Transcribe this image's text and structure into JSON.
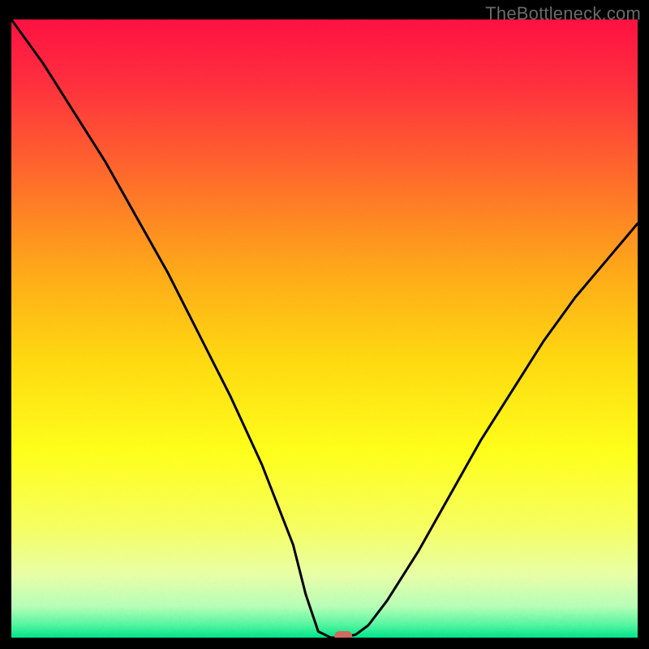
{
  "watermark": "TheBottleneck.com",
  "chart_data": {
    "type": "line",
    "title": "",
    "xlabel": "",
    "ylabel": "",
    "xlim": [
      0,
      100
    ],
    "ylim": [
      0,
      100
    ],
    "grid": false,
    "legend": false,
    "series": [
      {
        "name": "bottleneck-curve",
        "color": "#000000",
        "x": [
          0,
          5,
          10,
          15,
          20,
          25,
          30,
          35,
          40,
          45,
          47,
          49,
          51,
          53,
          55,
          57,
          60,
          65,
          70,
          75,
          80,
          85,
          90,
          95,
          100
        ],
        "y": [
          100,
          93,
          85,
          77,
          68,
          59,
          49,
          39,
          28,
          15,
          7,
          1,
          0,
          0,
          0.5,
          2,
          6,
          14,
          23,
          32,
          40,
          48,
          55,
          61,
          67
        ]
      }
    ],
    "marker": {
      "name": "optimal-point",
      "x": 53,
      "y": 0,
      "color": "#d1695c"
    },
    "background_gradient": {
      "type": "vertical-rainbow",
      "stops": [
        {
          "pos": 0.0,
          "color": "#ff1242"
        },
        {
          "pos": 0.1,
          "color": "#ff2f3f"
        },
        {
          "pos": 0.25,
          "color": "#ff6a2c"
        },
        {
          "pos": 0.4,
          "color": "#ffa71a"
        },
        {
          "pos": 0.55,
          "color": "#ffd911"
        },
        {
          "pos": 0.7,
          "color": "#ffff1c"
        },
        {
          "pos": 0.82,
          "color": "#f6ff60"
        },
        {
          "pos": 0.9,
          "color": "#e8ffa8"
        },
        {
          "pos": 0.95,
          "color": "#b7ffb7"
        },
        {
          "pos": 0.98,
          "color": "#55f5a0"
        },
        {
          "pos": 1.0,
          "color": "#00e68c"
        }
      ]
    }
  }
}
